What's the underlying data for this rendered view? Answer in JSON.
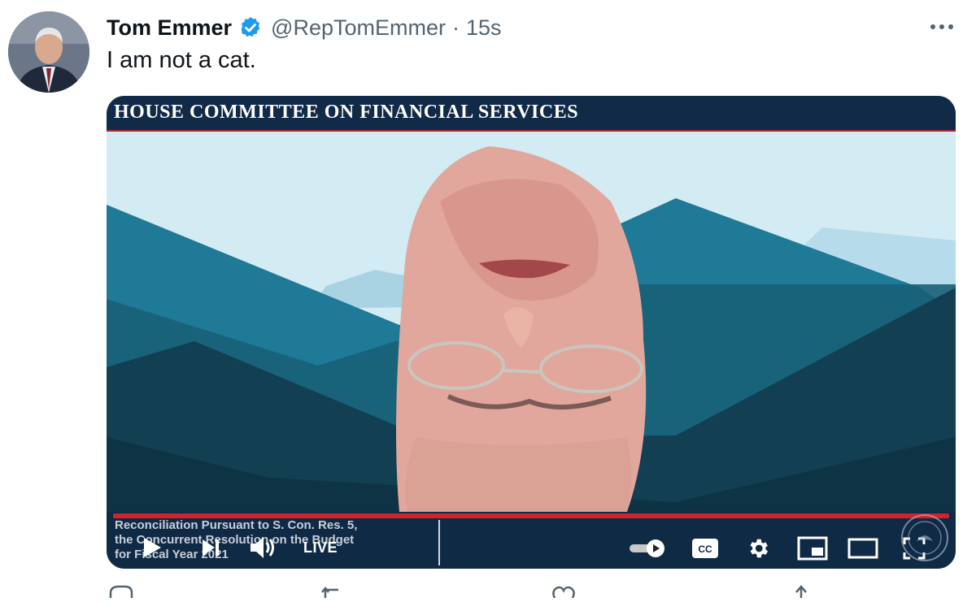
{
  "tweet": {
    "author_name": "Tom Emmer",
    "handle": "@RepTomEmmer",
    "separator": "·",
    "time": "15s",
    "text": "I am not a cat.",
    "verified": true
  },
  "video": {
    "banner_title": "HOUSE COMMITTEE ON FINANCIAL SERVICES",
    "caption": "Reconciliation Pursuant to S. Con. Res. 5,\nthe Concurrent Resolution on the Budget\nfor Fiscal Year 2021",
    "live_label": "LIVE",
    "icons": [
      "play-icon",
      "next-icon",
      "volume-icon",
      "autoplay-toggle-icon",
      "captions-icon",
      "settings-icon",
      "miniplayer-icon",
      "theater-icon",
      "fullscreen-icon"
    ]
  },
  "colors": {
    "verified_blue": "#1d9bf0",
    "banner_navy": "#112a48",
    "accent_red": "#d2232a",
    "sky": "#d3ebf3"
  }
}
